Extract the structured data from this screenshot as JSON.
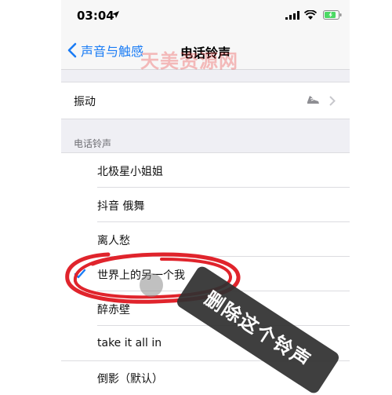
{
  "status_bar": {
    "time": "03:04"
  },
  "nav": {
    "back_label": "声音与触感",
    "title": "电话铃声"
  },
  "watermark": "天美资源网",
  "vibration": {
    "label": "振动"
  },
  "section": {
    "header": "电话铃声"
  },
  "ringtones": [
    {
      "name": "北极星小姐姐",
      "selected": false
    },
    {
      "name": "抖音 俄舞",
      "selected": false
    },
    {
      "name": "离人愁",
      "selected": false
    },
    {
      "name": "世界上的另一个我",
      "selected": true
    },
    {
      "name": "醉赤壁",
      "selected": false
    },
    {
      "name": "take it all in",
      "selected": false
    },
    {
      "name": "倒影（默认）",
      "selected": false
    }
  ],
  "annotation": {
    "note": "删除这个铃声"
  },
  "colors": {
    "accent": "#1a7cf5",
    "scribble": "#e0242c"
  }
}
